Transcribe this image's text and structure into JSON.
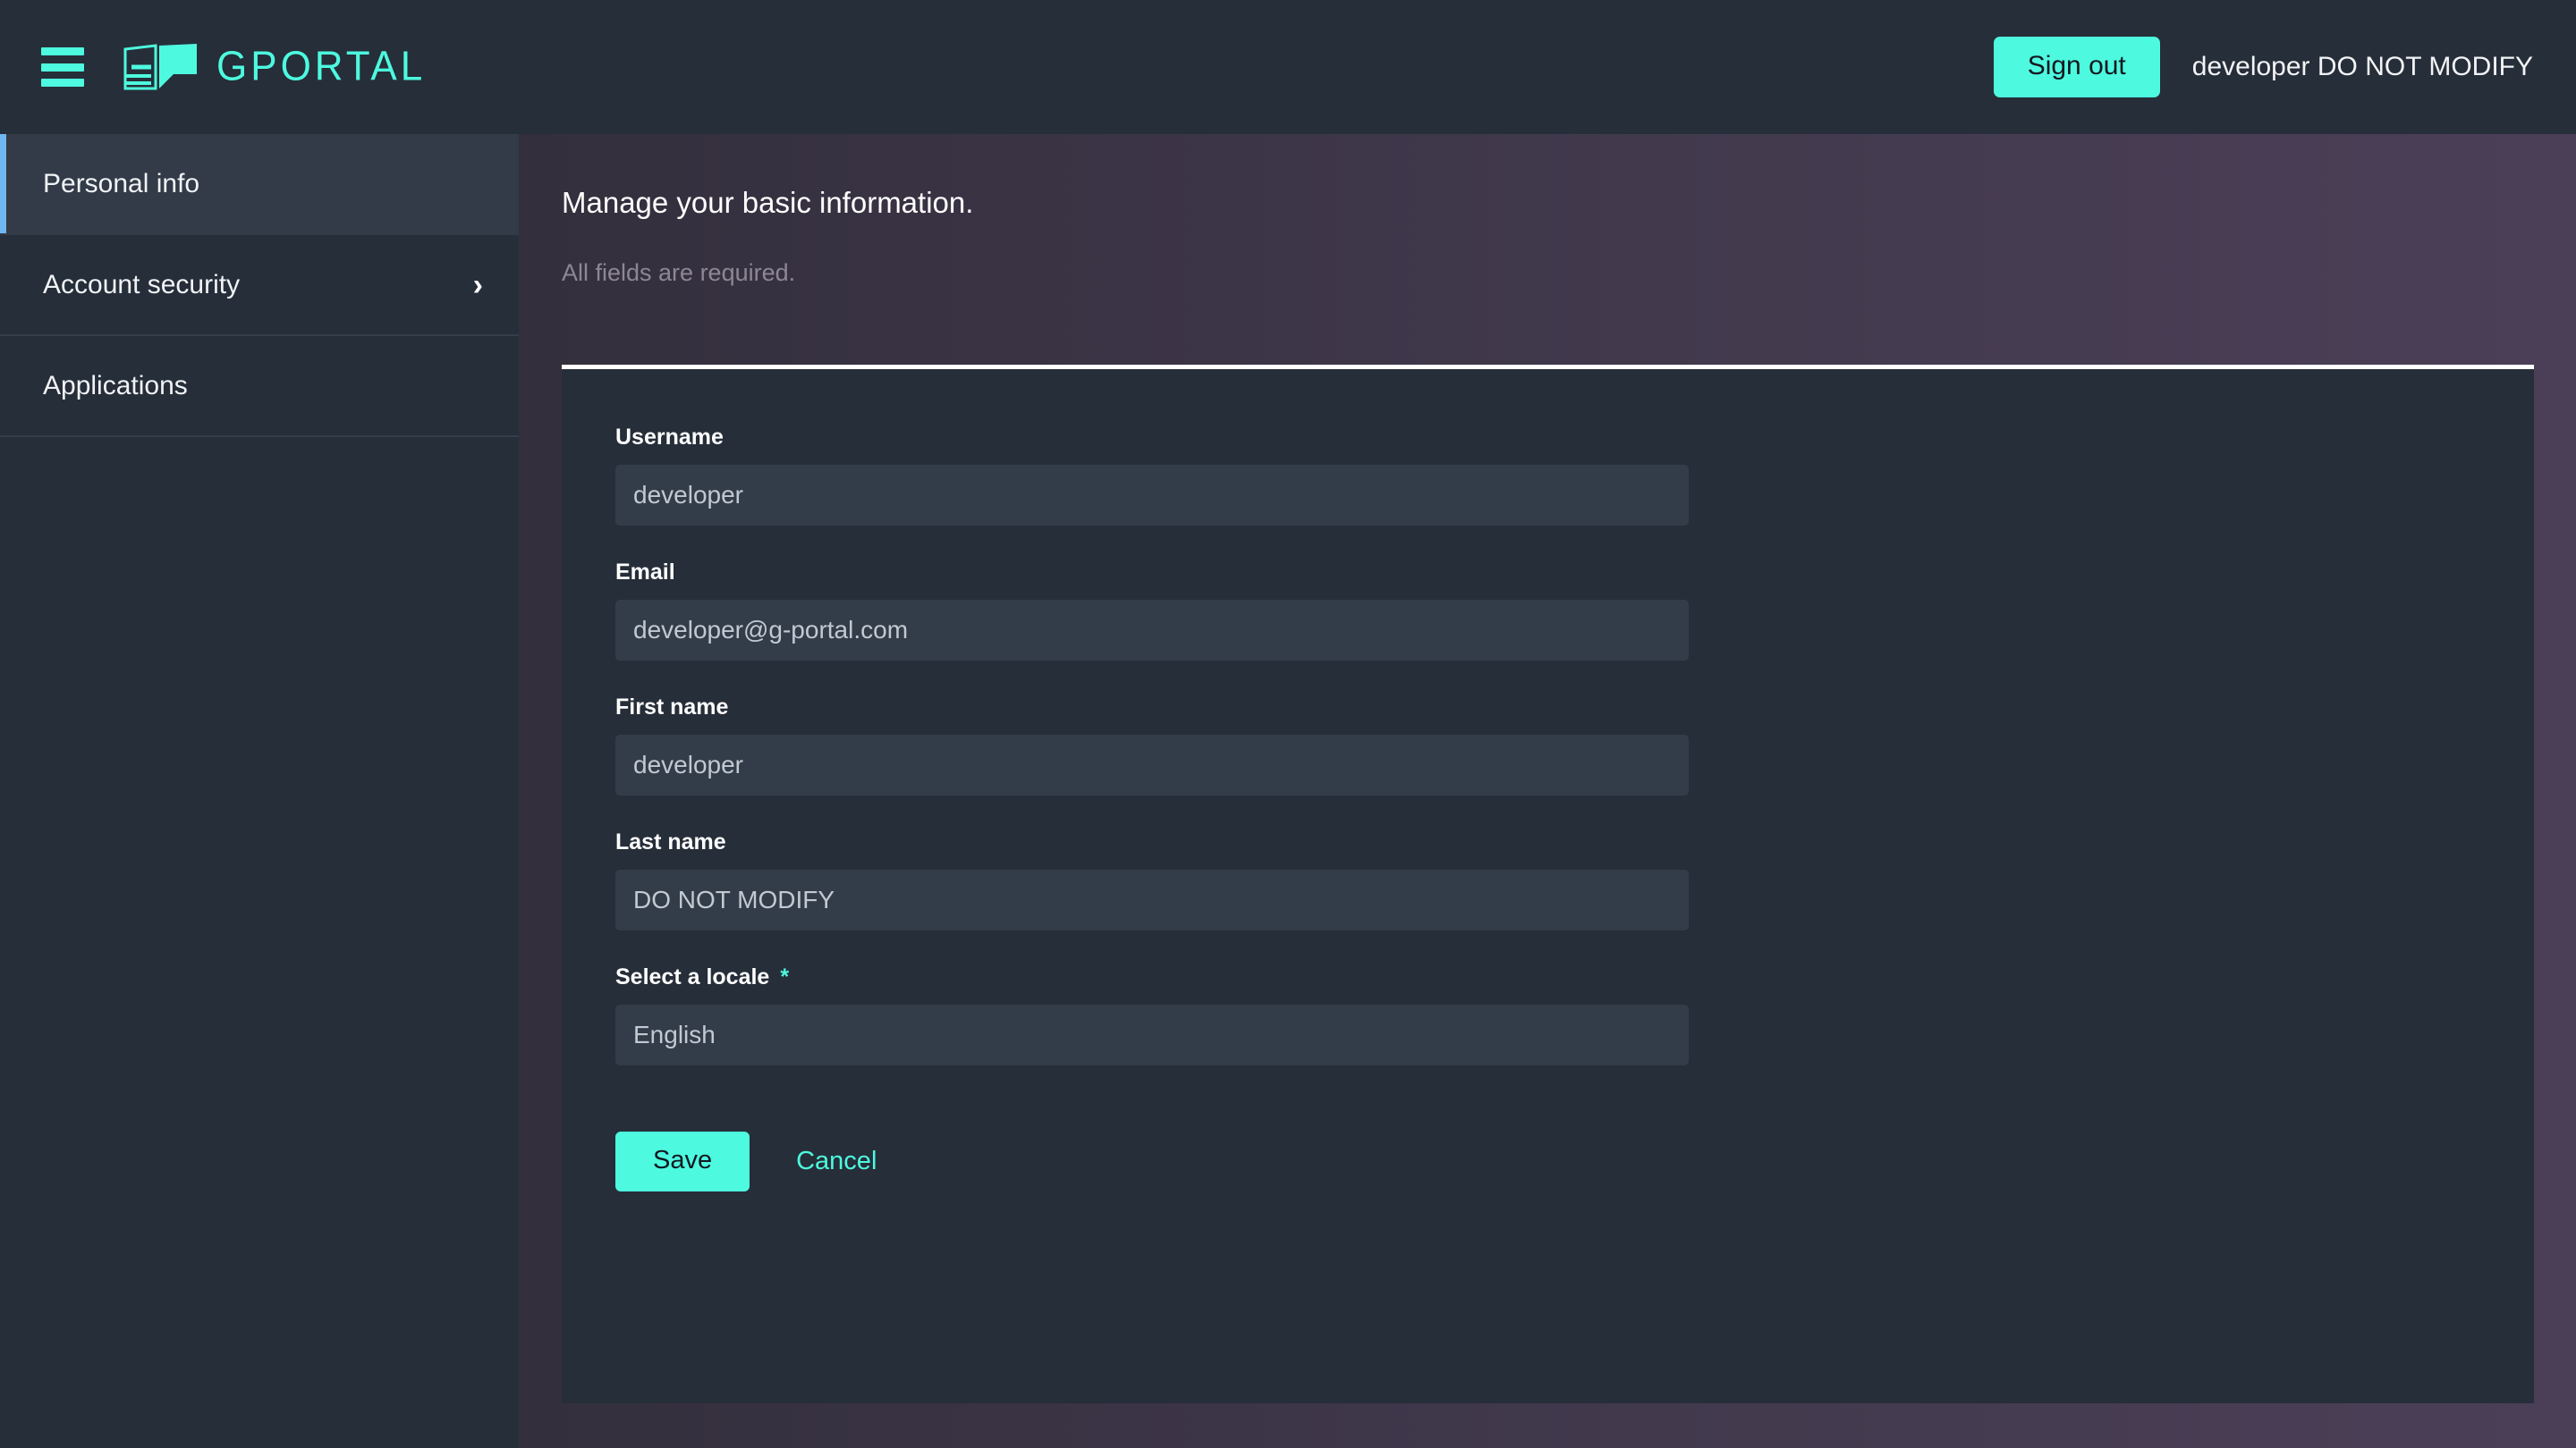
{
  "colors": {
    "accent": "#4dfadf",
    "active_indicator": "#6fb6f2",
    "page_bg": "#262e39",
    "panel_bg": "#262e39",
    "input_bg": "#333d4a",
    "header_gradient_start": "#332f3c",
    "header_gradient_end": "#4b3f57"
  },
  "topbar": {
    "menu_icon": "hamburger-menu-icon",
    "logo_icon": "gportal-logo-icon",
    "brand": "GPORTAL",
    "signout_label": "Sign out",
    "user_label": "developer DO NOT MODIFY"
  },
  "sidebar": {
    "items": [
      {
        "label": "Personal info",
        "active": true,
        "chevron": ""
      },
      {
        "label": "Account security",
        "active": false,
        "chevron": "›"
      },
      {
        "label": "Applications",
        "active": false,
        "chevron": ""
      }
    ]
  },
  "main": {
    "title": "Manage your basic information.",
    "subtitle": "All fields are required.",
    "fields": [
      {
        "label": "Username",
        "value": "developer",
        "required_mark": "",
        "placeholder": "Username"
      },
      {
        "label": "Email",
        "value": "developer@g-portal.com",
        "required_mark": "",
        "placeholder": "Email"
      },
      {
        "label": "First name",
        "value": "developer",
        "required_mark": "",
        "placeholder": "First name"
      },
      {
        "label": "Last name",
        "value": "DO NOT MODIFY",
        "required_mark": "",
        "placeholder": "Last name"
      },
      {
        "label": "Select a locale",
        "value": "English",
        "required_mark": "*",
        "placeholder": "Select a locale"
      }
    ],
    "save_label": "Save",
    "cancel_label": "Cancel"
  }
}
